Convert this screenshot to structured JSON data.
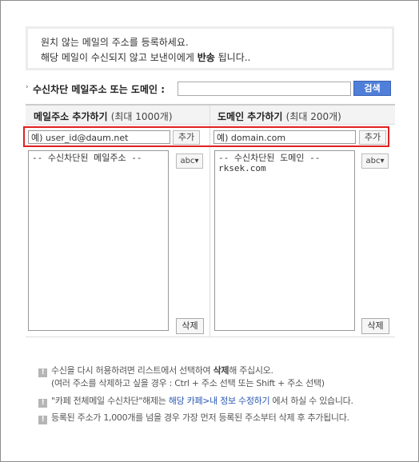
{
  "notice": {
    "line1": "원치 않는 메일의 주소를 등록하세요.",
    "line2_prefix": "해당 메일이 수신되지 않고 보낸이에게 ",
    "line2_bold": "반송",
    "line2_suffix": " 됩니다.."
  },
  "search": {
    "bullet": "›",
    "label": "수신차단 메일주소 또는 도메인 :",
    "value": "",
    "button_label": "검색"
  },
  "email_panel": {
    "title": "메일주소 추가하기",
    "limit": "(최대 1000개)",
    "input_value": "예) user_id@daum.net",
    "add_label": "추가",
    "list_items": [
      "-- 수신차단된 메일주소 --"
    ],
    "sort_label": "abc▾",
    "delete_label": "삭제"
  },
  "domain_panel": {
    "title": "도메인 추가하기",
    "limit": "(최대 200개)",
    "input_value": "예) domain.com",
    "add_label": "추가",
    "list_items": [
      "-- 수신차단된 도메인 --",
      "rksek.com"
    ],
    "sort_label": "abc▾",
    "delete_label": "삭제"
  },
  "info": {
    "mark": "!",
    "item1_prefix": "수신을 다시 허용하려면 리스트에서 선택하여 ",
    "item1_bold": "삭제",
    "item1_suffix": "해 주십시오.",
    "item1_sub": "(여러 주소를 삭제하고 싶을 경우 : Ctrl + 주소 선택 또는 Shift + 주소 선택)",
    "item2_prefix": "\"카페 전체메일 수신차단\"해제는 ",
    "item2_link": "해당 카페>내 정보 수정하기",
    "item2_suffix": " 에서 하실 수 있습니다.",
    "item3": "등록된 주소가 1,000개를 넘을 경우 가장 먼저 등록된 주소부터 삭제 후 추가됩니다."
  },
  "colors": {
    "highlight_border": "#e02020",
    "search_button": "#4f7fd9",
    "link": "#2a58b0"
  }
}
